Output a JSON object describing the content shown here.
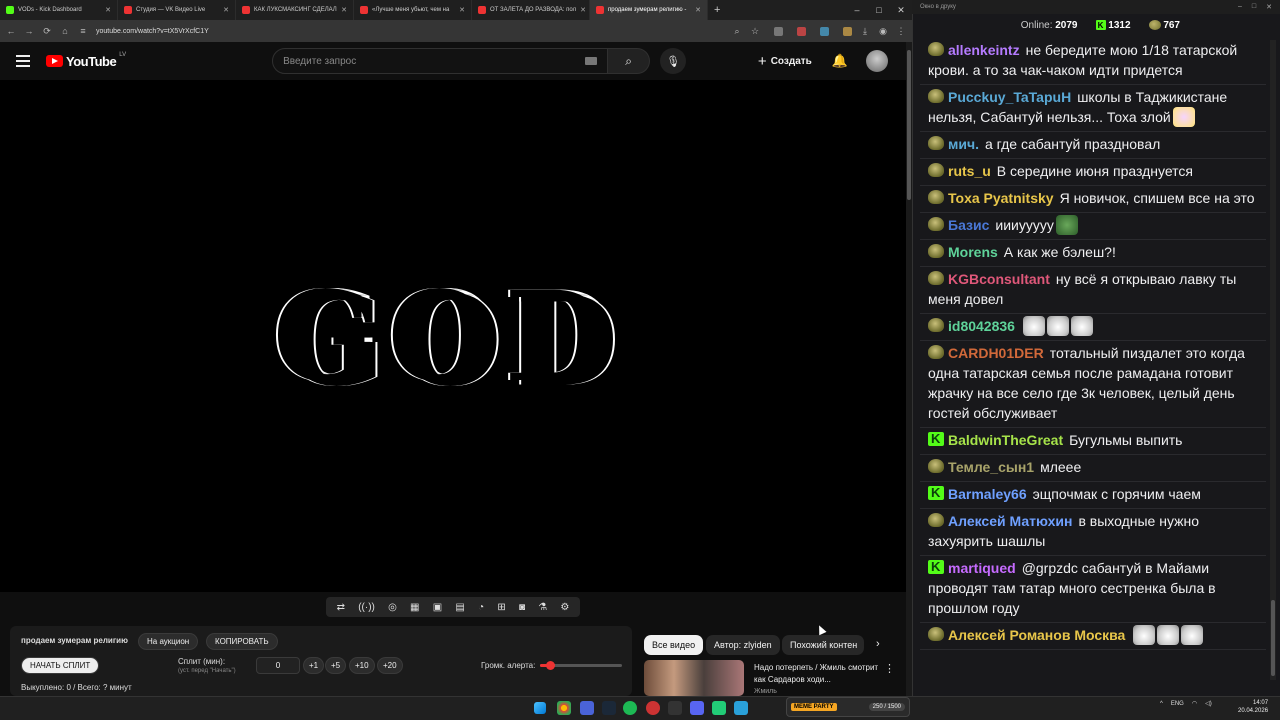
{
  "browser": {
    "tabs": [
      {
        "label": "VODs - Kick Dashboard",
        "color": "#53fc18"
      },
      {
        "label": "Студия — VK Видео Live",
        "color": "#e33"
      },
      {
        "label": "КАК ЛУКСМАКСИНГ СДЕЛАЛ",
        "color": "#e33"
      },
      {
        "label": "«Лучше меня убьют, чем на",
        "color": "#e33"
      },
      {
        "label": "ОТ ЗАЛЕТА ДО РАЗВОДА: пол",
        "color": "#e33"
      },
      {
        "label": "продаем зумерам религию -",
        "color": "#e33"
      }
    ],
    "url": "youtube.com/watch?v=tX5VrXcfC1Y"
  },
  "youtube": {
    "logo_text": "YouTube",
    "country": "LV",
    "search_placeholder": "Введите запрос",
    "create_label": "Создать",
    "video_text": "GOD",
    "chips": [
      "Все видео",
      "Автор: zlyiden",
      "Похожий контен"
    ],
    "rec_video": {
      "title": "Надо потерпеть / Жмиль смотрит как Сардаров ходи...",
      "channel": "Жмиль"
    }
  },
  "panel": {
    "title": "продаем зумерам религию",
    "auction_btn": "На аукцион",
    "copy_btn": "КОПИРОВАТЬ",
    "start_btn": "НАЧАТЬ СПЛИТ",
    "split_label": "Сплит (мин):",
    "split_sub": "(уст. перед \"Начать\")",
    "split_value": "0",
    "inc": [
      "+1",
      "+5",
      "+10",
      "+20"
    ],
    "volume_label": "Громк. алерта:",
    "volume_level": 0.12,
    "bought": "Выкуплено: 0 / Всего: ? минут"
  },
  "chat": {
    "window_title": "Окно в друку",
    "online_label": "Online:",
    "online_value": "2079",
    "kick_count": "1312",
    "other_count": "767",
    "messages": [
      {
        "badge": "pp",
        "user": "allenkeintz",
        "color": "#b57bff",
        "text": "не бередите мою 1/18 татарской крови. а то за чак-чаком идти придется",
        "emotes": []
      },
      {
        "badge": "pp",
        "user": "Pucckuy_TaTapuH",
        "color": "#5aa9d6",
        "text": "школы в Таджикистане нельзя, Сабантуй нельзя... Тоха злой",
        "emotes": [
          "pony"
        ]
      },
      {
        "badge": "pp",
        "user": "мич.",
        "color": "#5aa9d6",
        "text": "а где сабантуй праздновал",
        "emotes": []
      },
      {
        "badge": "pp",
        "user": "ruts_u",
        "color": "#e8c64a",
        "text": "В середине июня празднуется",
        "emotes": []
      },
      {
        "badge": "pp",
        "user": "Toxa Pyatnitsky",
        "color": "#e8c64a",
        "text": "Я новичок, спишем все на это",
        "emotes": []
      },
      {
        "badge": "pp",
        "user": "Базис",
        "color": "#4a78d6",
        "text": "иииууууу",
        "emotes": [
          "frog"
        ]
      },
      {
        "badge": "pp",
        "user": "Morens",
        "color": "#5fd39a",
        "text": "А как же бэлеш?!",
        "emotes": []
      },
      {
        "badge": "pp",
        "user": "KGBconsultant",
        "color": "#e0587a",
        "text": "ну всё я открываю лавку ты меня довел",
        "emotes": []
      },
      {
        "badge": "pp",
        "user": "id8042836",
        "color": "#5fd39a",
        "text": "",
        "emotes": [
          "cat",
          "cat",
          "cat"
        ]
      },
      {
        "badge": "pp",
        "user": "CARDH01DER",
        "color": "#d2693a",
        "text": "тотальный пиздалет это когда одна татарская семья после рамадана готовит жрачку на все село где 3к человек, целый день гостей обслуживает",
        "emotes": []
      },
      {
        "badge": "kk",
        "user": "BaldwinTheGreat",
        "color": "#a6e34a",
        "text": "Бугульмы выпить",
        "emotes": []
      },
      {
        "badge": "pp",
        "user": "Темле_сын1",
        "color": "#a8a36a",
        "text": "млеее",
        "emotes": []
      },
      {
        "badge": "kk",
        "user": "Barmaley66",
        "color": "#6fa0ff",
        "text": "эщпочмак с горячим чаем",
        "emotes": []
      },
      {
        "badge": "pp",
        "user": "Алексей Матюхин",
        "color": "#6fa0ff",
        "text": "в выходные нужно захуярить шашлы",
        "emotes": []
      },
      {
        "badge": "kk",
        "user": "martiqued",
        "color": "#c66bff",
        "text": "@grpzdc сабантуй в Майами проводят там татар много сестренка была в прошлом году",
        "emotes": []
      },
      {
        "badge": "pp",
        "user": "Алексей Романов Москва",
        "color": "#e8c64a",
        "text": "",
        "emotes": [
          "cat",
          "cat",
          "cat"
        ]
      }
    ]
  },
  "taskbar": {
    "memes_tag": "МЕМЕ PARTY",
    "memes_count": "250 / 1500",
    "lang": "ENG",
    "time": "14:07",
    "date": "20.04.2026"
  }
}
